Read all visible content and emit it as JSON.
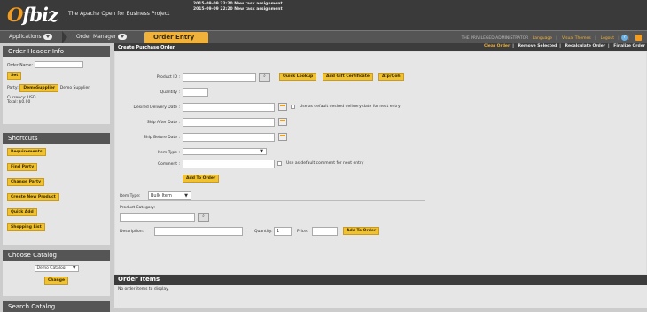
{
  "header": {
    "logo_o": "O",
    "logo_rest": "fbiz",
    "tagline": "The Apache Open for Business Project",
    "messages": [
      "2015-09-09 22:20 New task assignment",
      "2015-09-09 22:20 New task assignment"
    ]
  },
  "nav": {
    "applications": "Applications",
    "order_manager": "Order Manager",
    "order_entry": "Order Entry",
    "user": "THE PRIVILEGED ADMINISTRATOR",
    "language": "Language",
    "visual_themes": "Visual Themes",
    "logout": "Logout",
    "help_glyph": "?"
  },
  "sidebar": {
    "order_header": {
      "title": "Order Header Info",
      "order_name_label": "Order Name:",
      "set_label": "Set",
      "party_label": "Party:",
      "party_button": "DemoSupplier",
      "party_name": "Demo Supplier",
      "currency": "Currency: USD",
      "total": "Total: $0.00"
    },
    "shortcuts": {
      "title": "Shortcuts",
      "items": [
        "Requirements",
        "Find Party",
        "Change Party",
        "Create New Product",
        "Quick Add",
        "Shopping List"
      ]
    },
    "catalog": {
      "title": "Choose Catalog",
      "selected": "Demo Catalog",
      "change_label": "Change"
    },
    "search_title": "Search Catalog"
  },
  "main": {
    "title": "Create Purchase Order",
    "links": [
      "Clear Order",
      "Remove Selected",
      "Recalculate Order",
      "Finalize Order"
    ],
    "product_id_label": "Product ID :",
    "quick_lookup": "Quick Lookup",
    "add_gift_certificate": "Add Gift Certificate",
    "atp_qoh": "Atp/Qoh",
    "quantity_label": "Quantity :",
    "desired_delivery_label": "Desired Delivery Date :",
    "desired_delivery_note": "Use as default desired delivery date for next entry",
    "ship_after_label": "Ship After Date :",
    "ship_before_label": "Ship Before Date :",
    "item_type_label": "Item Type :",
    "comment_label": "Comment :",
    "comment_note": "Use as default comment for next entry",
    "add_to_order": "Add To Order",
    "bulk_item_type_label": "Item Type:",
    "bulk_item_type_value": "Bulk Item",
    "product_category_label": "Product Category:",
    "description_label": "Description:",
    "bulk_quantity_label": "Quantity:",
    "bulk_quantity_value": "1",
    "price_label": "Price:",
    "bulk_add_to_order": "Add To Order"
  },
  "order_items": {
    "title": "Order Items",
    "empty": "No order items to display."
  },
  "icons": {
    "lookup": "lookup-icon",
    "calendar": "calendar-icon",
    "dropdown": "chevron-down-icon"
  }
}
